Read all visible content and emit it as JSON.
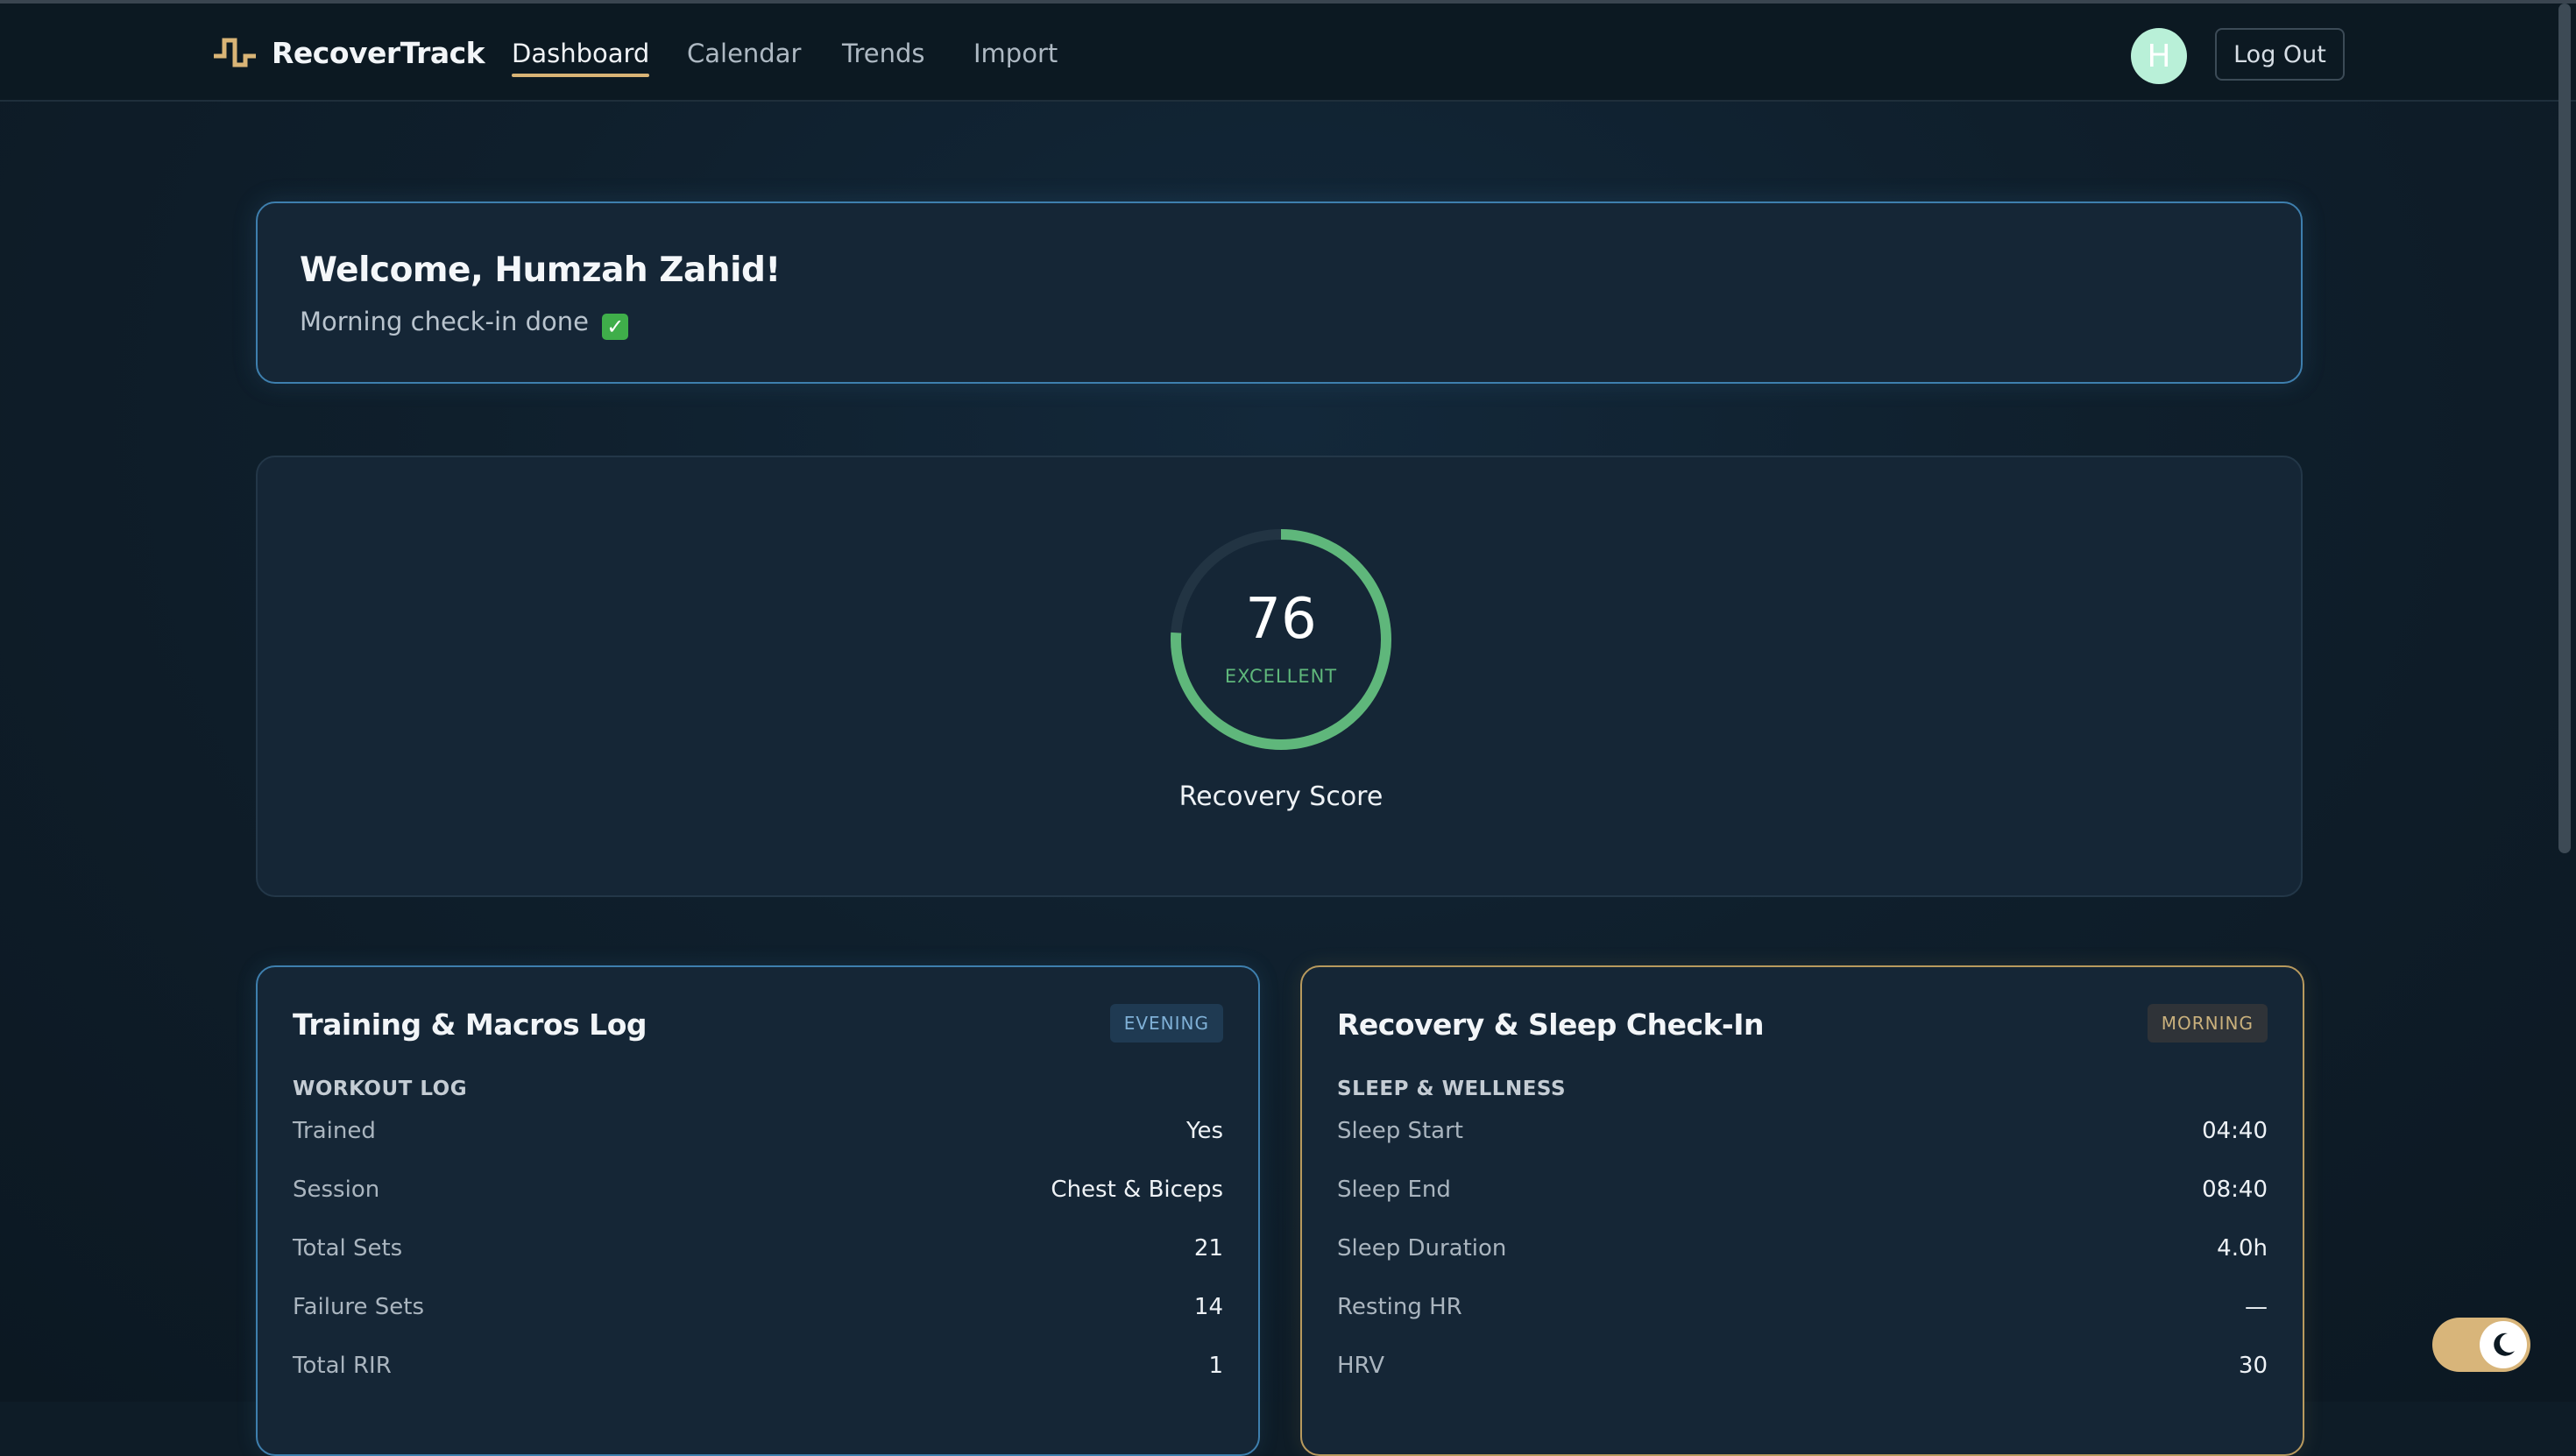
{
  "nav": {
    "brand": "RecoverTrack",
    "links": [
      "Dashboard",
      "Calendar",
      "Trends",
      "Import"
    ],
    "active": "Dashboard",
    "avatar_initial": "H",
    "logout_label": "Log Out"
  },
  "welcome": {
    "title": "Welcome, Humzah Zahid!",
    "subtitle": "Morning check-in done",
    "check_icon": "check-mark-icon"
  },
  "recovery": {
    "score": "76",
    "fraction": 0.76,
    "status": "EXCELLENT",
    "label": "Recovery Score",
    "color": "#5fb77b"
  },
  "training": {
    "title": "Training & Macros Log",
    "badge": "EVENING",
    "section": "WORKOUT LOG",
    "rows": [
      {
        "k": "Trained",
        "v": "Yes"
      },
      {
        "k": "Session",
        "v": "Chest & Biceps"
      },
      {
        "k": "Total Sets",
        "v": "21"
      },
      {
        "k": "Failure Sets",
        "v": "14"
      },
      {
        "k": "Total RIR",
        "v": "1"
      }
    ]
  },
  "sleep": {
    "title": "Recovery & Sleep Check-In",
    "badge": "MORNING",
    "section": "SLEEP & WELLNESS",
    "rows": [
      {
        "k": "Sleep Start",
        "v": "04:40"
      },
      {
        "k": "Sleep End",
        "v": "08:40"
      },
      {
        "k": "Sleep Duration",
        "v": "4.0h"
      },
      {
        "k": "Resting HR",
        "v": "—"
      },
      {
        "k": "HRV",
        "v": "30"
      }
    ]
  },
  "colors": {
    "accent_gold": "#d9b476",
    "accent_blue": "#3e7fae",
    "ring_green": "#5fb77b"
  },
  "theme_toggle_icon": "moon-icon"
}
